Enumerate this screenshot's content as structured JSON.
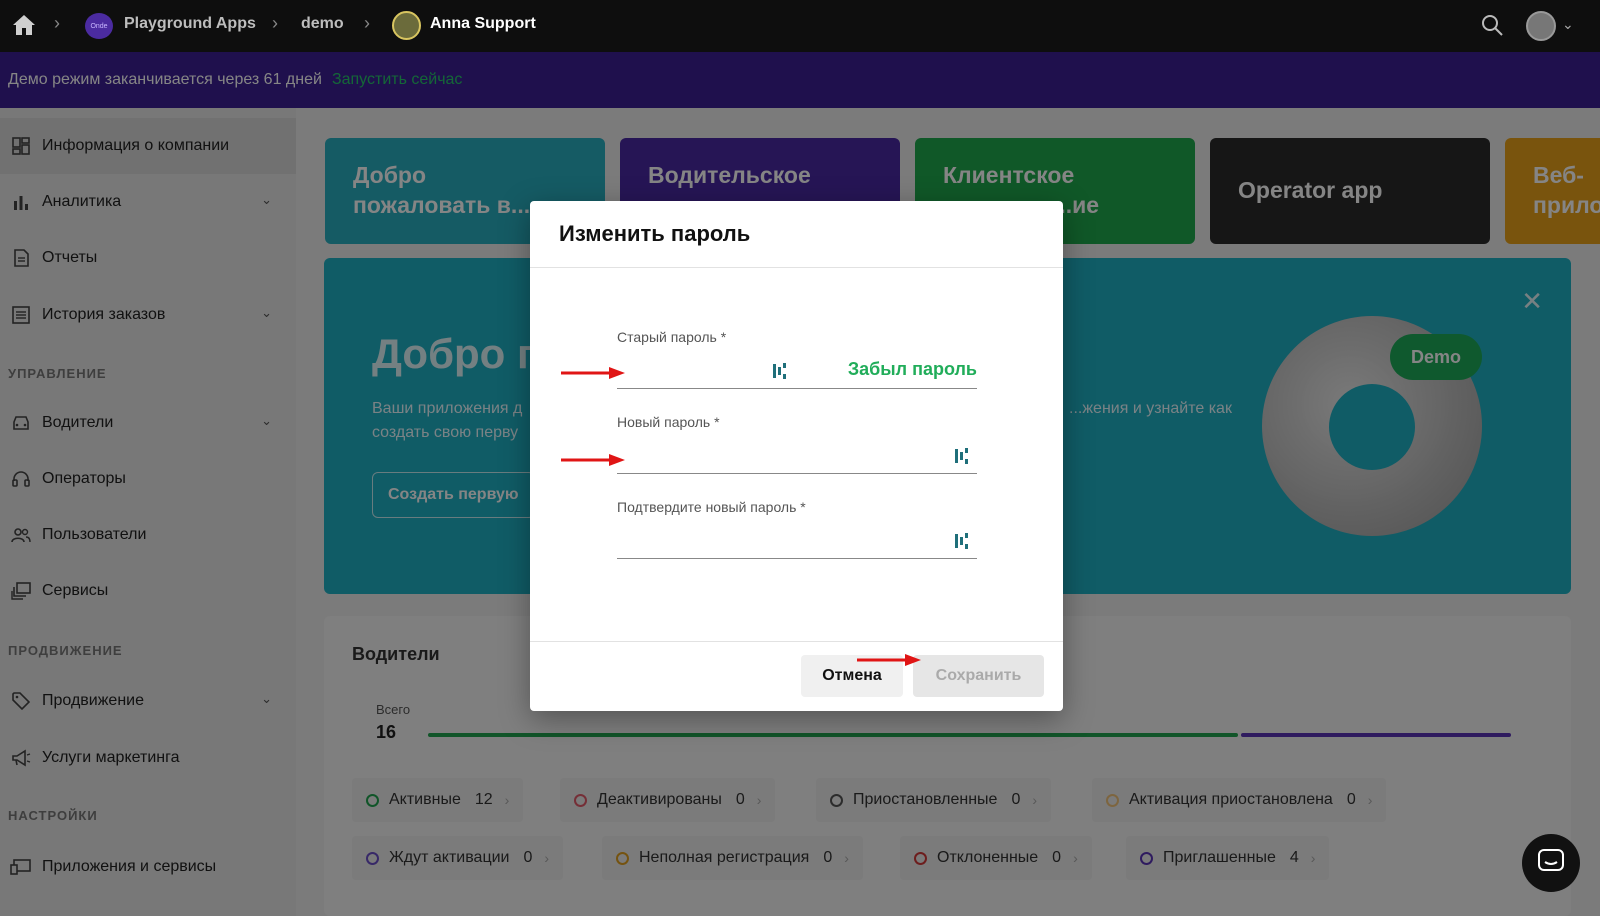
{
  "topbar": {
    "app_logo_text": "Onde",
    "breadcrumbs": [
      "Playground Apps",
      "demo",
      "Anna Support"
    ]
  },
  "banner": {
    "message": "Демо режим заканчивается через 61 дней",
    "action": "Запустить сейчас"
  },
  "sidebar": {
    "items": [
      {
        "label": "Информация о компании",
        "icon": "dashboard-icon"
      },
      {
        "label": "Аналитика",
        "icon": "bar-chart-icon",
        "expandable": true
      },
      {
        "label": "Отчеты",
        "icon": "document-icon"
      },
      {
        "label": "История заказов",
        "icon": "list-icon",
        "expandable": true
      }
    ],
    "sections": [
      {
        "title": "УПРАВЛЕНИЕ",
        "items": [
          {
            "label": "Водители",
            "icon": "car-icon",
            "expandable": true
          },
          {
            "label": "Операторы",
            "icon": "headset-icon"
          },
          {
            "label": "Пользователи",
            "icon": "users-icon"
          },
          {
            "label": "Сервисы",
            "icon": "services-icon"
          }
        ]
      },
      {
        "title": "ПРОДВИЖЕНИЕ",
        "items": [
          {
            "label": "Продвижение",
            "icon": "tag-icon",
            "expandable": true
          },
          {
            "label": "Услуги маркетинга",
            "icon": "megaphone-icon"
          }
        ]
      },
      {
        "title": "НАСТРОЙКИ",
        "items": [
          {
            "label": "Приложения и сервисы",
            "icon": "devices-icon"
          }
        ]
      }
    ]
  },
  "cards": [
    {
      "line1": "Добро",
      "line2": "пожаловать в...",
      "color": "#2aaec0"
    },
    {
      "line1": "Водительское",
      "line2": "",
      "color": "#4a2aa3"
    },
    {
      "line1": "Клиентское",
      "line2": "...ие",
      "color": "#1fa94e"
    },
    {
      "line1": "Operator app",
      "line2": "",
      "color": "#2b2b2b"
    },
    {
      "line1": "Веб-",
      "line2": "прило",
      "color": "#e8a21a"
    }
  ],
  "welcome": {
    "title": "Добро п",
    "desc_line1": "Ваши приложения д",
    "desc_line2": "создать свою перву",
    "desc_right": "...жения и узнайте как",
    "create_button": "Создать первую",
    "demo_badge": "Demo"
  },
  "drivers": {
    "heading": "Водители",
    "total_label": "Всего",
    "total_value": "16",
    "statuses": [
      {
        "label": "Активные",
        "count": "12",
        "color": "#21a34f"
      },
      {
        "label": "Деактивированы",
        "count": "0",
        "color": "#e05a6a"
      },
      {
        "label": "Приостановленные",
        "count": "0",
        "color": "#555555"
      },
      {
        "label": "Активация приостановлена",
        "count": "0",
        "color": "#f0c27a"
      },
      {
        "label": "Ждут активации",
        "count": "0",
        "color": "#6b4fc8"
      },
      {
        "label": "Неполная регистрация",
        "count": "0",
        "color": "#e0a020"
      },
      {
        "label": "Отклоненные",
        "count": "0",
        "color": "#d23b3b"
      },
      {
        "label": "Приглашенные",
        "count": "4",
        "color": "#5a35b6"
      }
    ]
  },
  "modal": {
    "title": "Изменить пароль",
    "old_password_label": "Старый пароль *",
    "forgot_link": "Забыл пароль",
    "new_password_label": "Новый пароль *",
    "confirm_password_label": "Подтвердите новый пароль *",
    "cancel_button": "Отмена",
    "save_button": "Сохранить"
  }
}
